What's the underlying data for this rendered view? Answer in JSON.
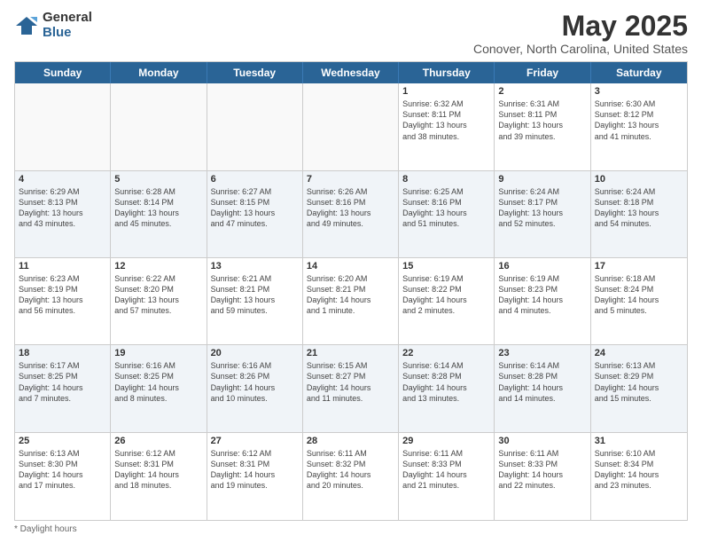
{
  "header": {
    "logo_general": "General",
    "logo_blue": "Blue",
    "month_title": "May 2025",
    "subtitle": "Conover, North Carolina, United States"
  },
  "weekdays": [
    "Sunday",
    "Monday",
    "Tuesday",
    "Wednesday",
    "Thursday",
    "Friday",
    "Saturday"
  ],
  "weeks": [
    [
      {
        "day": "",
        "info": ""
      },
      {
        "day": "",
        "info": ""
      },
      {
        "day": "",
        "info": ""
      },
      {
        "day": "",
        "info": ""
      },
      {
        "day": "1",
        "info": "Sunrise: 6:32 AM\nSunset: 8:11 PM\nDaylight: 13 hours\nand 38 minutes."
      },
      {
        "day": "2",
        "info": "Sunrise: 6:31 AM\nSunset: 8:11 PM\nDaylight: 13 hours\nand 39 minutes."
      },
      {
        "day": "3",
        "info": "Sunrise: 6:30 AM\nSunset: 8:12 PM\nDaylight: 13 hours\nand 41 minutes."
      }
    ],
    [
      {
        "day": "4",
        "info": "Sunrise: 6:29 AM\nSunset: 8:13 PM\nDaylight: 13 hours\nand 43 minutes."
      },
      {
        "day": "5",
        "info": "Sunrise: 6:28 AM\nSunset: 8:14 PM\nDaylight: 13 hours\nand 45 minutes."
      },
      {
        "day": "6",
        "info": "Sunrise: 6:27 AM\nSunset: 8:15 PM\nDaylight: 13 hours\nand 47 minutes."
      },
      {
        "day": "7",
        "info": "Sunrise: 6:26 AM\nSunset: 8:16 PM\nDaylight: 13 hours\nand 49 minutes."
      },
      {
        "day": "8",
        "info": "Sunrise: 6:25 AM\nSunset: 8:16 PM\nDaylight: 13 hours\nand 51 minutes."
      },
      {
        "day": "9",
        "info": "Sunrise: 6:24 AM\nSunset: 8:17 PM\nDaylight: 13 hours\nand 52 minutes."
      },
      {
        "day": "10",
        "info": "Sunrise: 6:24 AM\nSunset: 8:18 PM\nDaylight: 13 hours\nand 54 minutes."
      }
    ],
    [
      {
        "day": "11",
        "info": "Sunrise: 6:23 AM\nSunset: 8:19 PM\nDaylight: 13 hours\nand 56 minutes."
      },
      {
        "day": "12",
        "info": "Sunrise: 6:22 AM\nSunset: 8:20 PM\nDaylight: 13 hours\nand 57 minutes."
      },
      {
        "day": "13",
        "info": "Sunrise: 6:21 AM\nSunset: 8:21 PM\nDaylight: 13 hours\nand 59 minutes."
      },
      {
        "day": "14",
        "info": "Sunrise: 6:20 AM\nSunset: 8:21 PM\nDaylight: 14 hours\nand 1 minute."
      },
      {
        "day": "15",
        "info": "Sunrise: 6:19 AM\nSunset: 8:22 PM\nDaylight: 14 hours\nand 2 minutes."
      },
      {
        "day": "16",
        "info": "Sunrise: 6:19 AM\nSunset: 8:23 PM\nDaylight: 14 hours\nand 4 minutes."
      },
      {
        "day": "17",
        "info": "Sunrise: 6:18 AM\nSunset: 8:24 PM\nDaylight: 14 hours\nand 5 minutes."
      }
    ],
    [
      {
        "day": "18",
        "info": "Sunrise: 6:17 AM\nSunset: 8:25 PM\nDaylight: 14 hours\nand 7 minutes."
      },
      {
        "day": "19",
        "info": "Sunrise: 6:16 AM\nSunset: 8:25 PM\nDaylight: 14 hours\nand 8 minutes."
      },
      {
        "day": "20",
        "info": "Sunrise: 6:16 AM\nSunset: 8:26 PM\nDaylight: 14 hours\nand 10 minutes."
      },
      {
        "day": "21",
        "info": "Sunrise: 6:15 AM\nSunset: 8:27 PM\nDaylight: 14 hours\nand 11 minutes."
      },
      {
        "day": "22",
        "info": "Sunrise: 6:14 AM\nSunset: 8:28 PM\nDaylight: 14 hours\nand 13 minutes."
      },
      {
        "day": "23",
        "info": "Sunrise: 6:14 AM\nSunset: 8:28 PM\nDaylight: 14 hours\nand 14 minutes."
      },
      {
        "day": "24",
        "info": "Sunrise: 6:13 AM\nSunset: 8:29 PM\nDaylight: 14 hours\nand 15 minutes."
      }
    ],
    [
      {
        "day": "25",
        "info": "Sunrise: 6:13 AM\nSunset: 8:30 PM\nDaylight: 14 hours\nand 17 minutes."
      },
      {
        "day": "26",
        "info": "Sunrise: 6:12 AM\nSunset: 8:31 PM\nDaylight: 14 hours\nand 18 minutes."
      },
      {
        "day": "27",
        "info": "Sunrise: 6:12 AM\nSunset: 8:31 PM\nDaylight: 14 hours\nand 19 minutes."
      },
      {
        "day": "28",
        "info": "Sunrise: 6:11 AM\nSunset: 8:32 PM\nDaylight: 14 hours\nand 20 minutes."
      },
      {
        "day": "29",
        "info": "Sunrise: 6:11 AM\nSunset: 8:33 PM\nDaylight: 14 hours\nand 21 minutes."
      },
      {
        "day": "30",
        "info": "Sunrise: 6:11 AM\nSunset: 8:33 PM\nDaylight: 14 hours\nand 22 minutes."
      },
      {
        "day": "31",
        "info": "Sunrise: 6:10 AM\nSunset: 8:34 PM\nDaylight: 14 hours\nand 23 minutes."
      }
    ]
  ],
  "footer": {
    "note": "Daylight hours"
  }
}
